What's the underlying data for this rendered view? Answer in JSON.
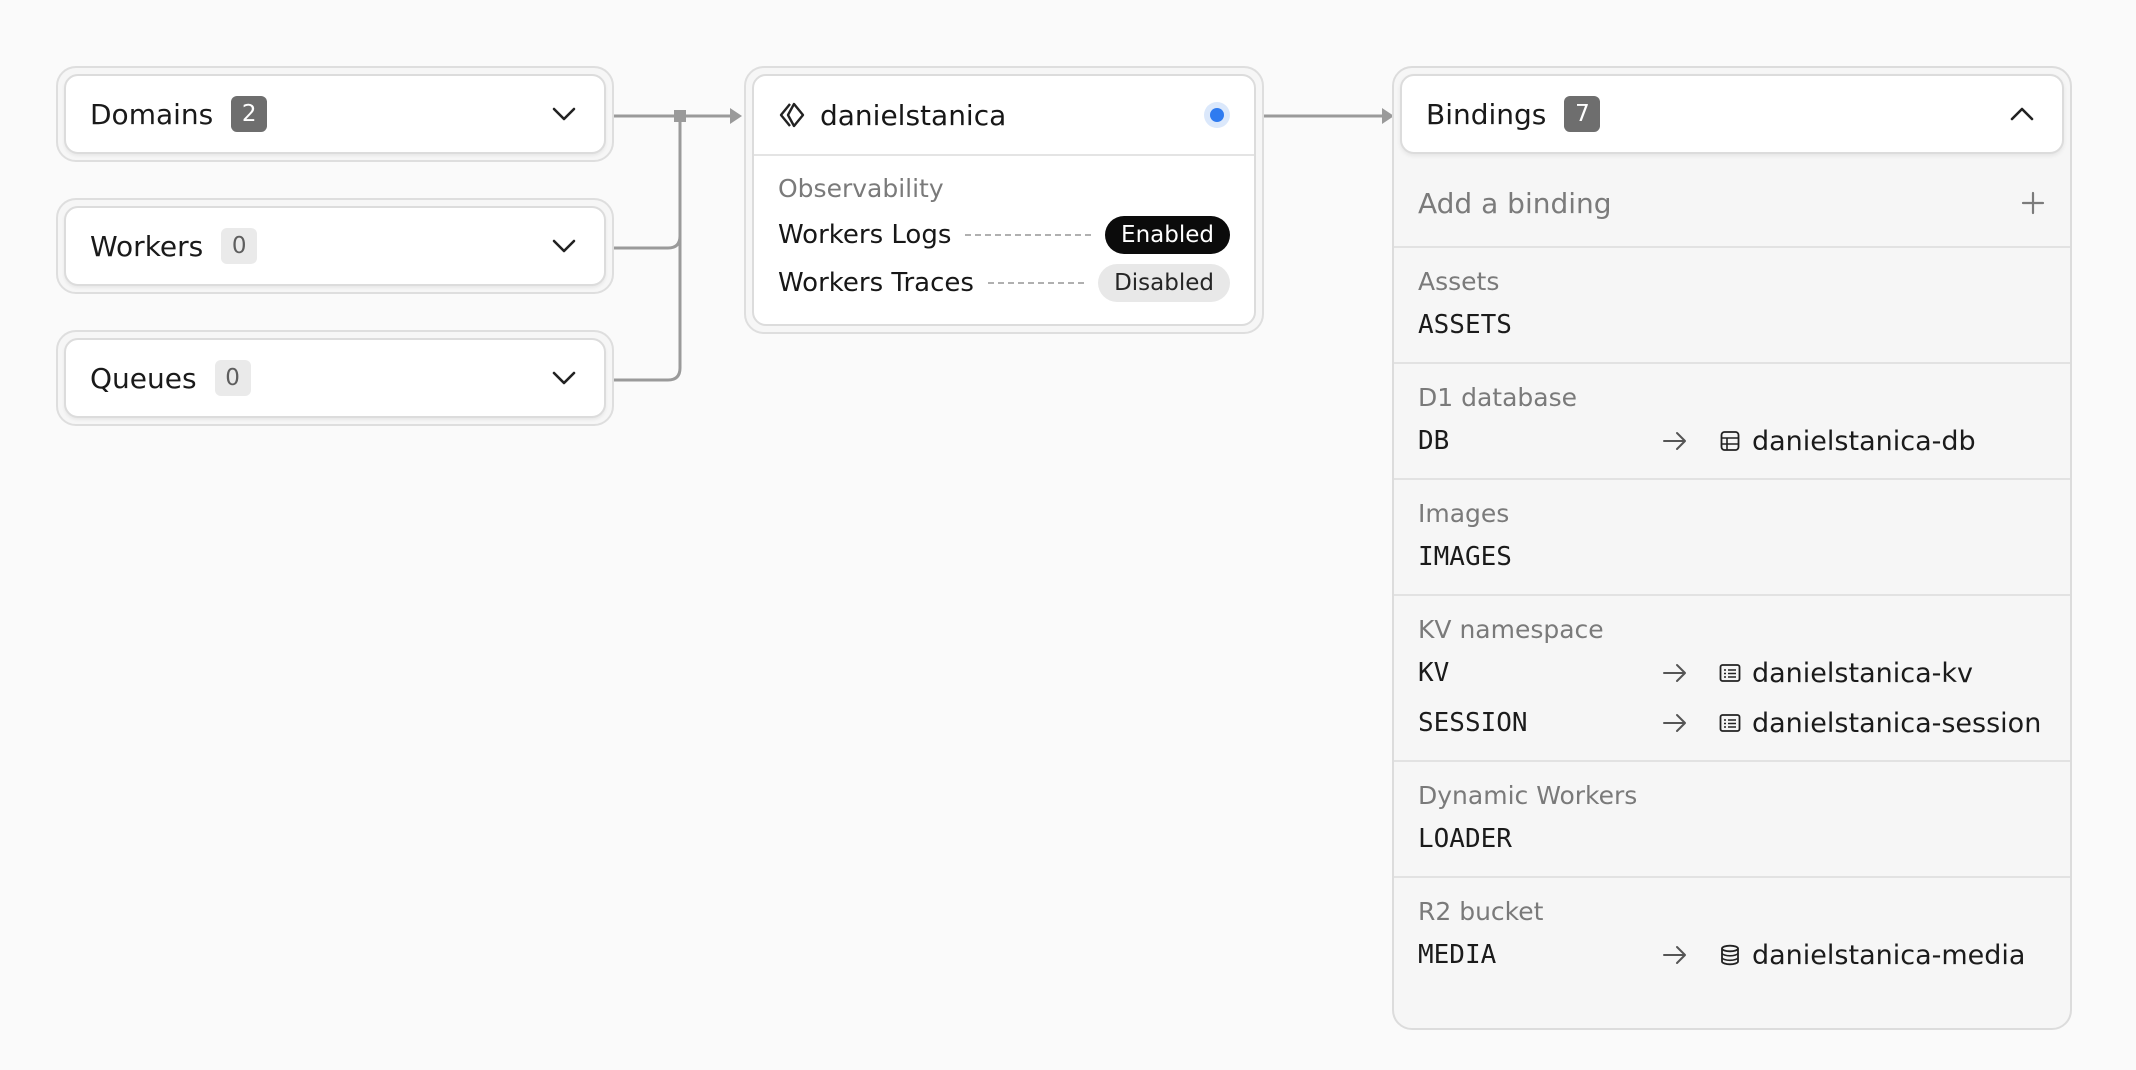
{
  "left_cards": [
    {
      "label": "Domains",
      "count": "2"
    },
    {
      "label": "Workers",
      "count": "0"
    },
    {
      "label": "Queues",
      "count": "0"
    }
  ],
  "worker": {
    "name": "danielstanica",
    "observability_title": "Observability",
    "logs_label": "Workers Logs",
    "logs_status": "Enabled",
    "traces_label": "Workers Traces",
    "traces_status": "Disabled"
  },
  "bindings": {
    "title": "Bindings",
    "count": "7",
    "add_label": "Add a binding",
    "groups": [
      {
        "title": "Assets",
        "items": [
          {
            "name": "ASSETS"
          }
        ]
      },
      {
        "title": "D1 database",
        "items": [
          {
            "name": "DB",
            "target": "danielstanica-db",
            "icon": "database-table-icon"
          }
        ]
      },
      {
        "title": "Images",
        "items": [
          {
            "name": "IMAGES"
          }
        ]
      },
      {
        "title": "KV namespace",
        "items": [
          {
            "name": "KV",
            "target": "danielstanica-kv",
            "icon": "kv-list-icon"
          },
          {
            "name": "SESSION",
            "target": "danielstanica-session",
            "icon": "kv-list-icon"
          }
        ]
      },
      {
        "title": "Dynamic Workers",
        "items": [
          {
            "name": "LOADER"
          }
        ]
      },
      {
        "title": "R2 bucket",
        "items": [
          {
            "name": "MEDIA",
            "target": "danielstanica-media",
            "icon": "bucket-icon"
          }
        ]
      }
    ]
  },
  "colors": {
    "accent": "#2f7bf0",
    "connector": "#9a9a9a",
    "enabled_pill": "#0b0b0b",
    "disabled_pill": "#e8e8e8"
  }
}
